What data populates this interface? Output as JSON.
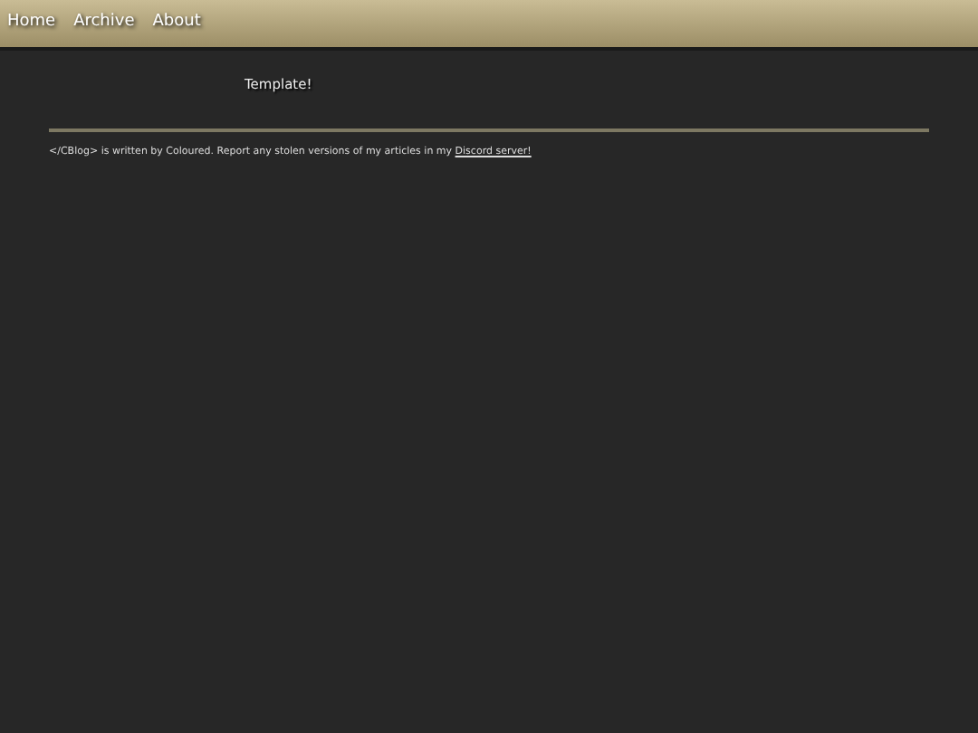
{
  "nav": [
    {
      "label": "Home"
    },
    {
      "label": "Archive"
    },
    {
      "label": "About"
    }
  ],
  "content": {
    "text": "Template!"
  },
  "footer": {
    "text": "</CBlog> is written by Coloured. Report any stolen versions of my articles in my ",
    "link": "Discord server!"
  }
}
